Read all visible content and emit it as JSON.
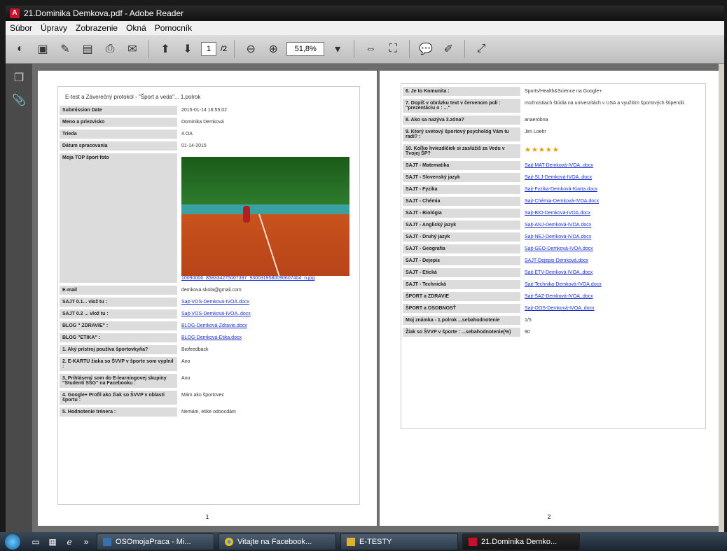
{
  "window": {
    "title": "21.Dominika Demkova.pdf - Adobe Reader"
  },
  "menu": [
    "Súbor",
    "Úpravy",
    "Zobrazenie",
    "Okná",
    "Pomocník"
  ],
  "toolbar": {
    "page_current": "1",
    "page_total": "/2",
    "zoom": "51,8%"
  },
  "page1": {
    "form_title": "E-test a Záverečný protokol - \"Šport a veda\"... 1.polrok",
    "rows": [
      {
        "label": "Submission Date",
        "value": "2015-01-14 16:55:02"
      },
      {
        "label": "Meno a priezvisko",
        "value": "Dominika Demková"
      },
      {
        "label": "Trieda",
        "value": "4.OA"
      },
      {
        "label": "Dátum spracovania",
        "value": "01-14-2015"
      }
    ],
    "photo_label": "Moja TOP šport foto",
    "photo_link": "10090006_858334275007397_9300319580090607404_n.jpg",
    "rows2": [
      {
        "label": "E-mail",
        "value": "demkova.skola@gmail.com"
      },
      {
        "label": "SAJT 0.1... vlož tu :",
        "value": "Sajt-VOS-Demková-IVOA.docx",
        "link": true
      },
      {
        "label": "SAJT 0.2 ... vlož tu :",
        "value": "Sajt-VOS-Demková-IVOA..docx",
        "link": true
      },
      {
        "label": "BLOG \" ZDRAVIE\" :",
        "value": "BLOG-Demková-Zdravie.docx",
        "link": true
      },
      {
        "label": "BLOG \"ETIKA\" :",
        "value": "BLOG-Demková-Etika.docx",
        "link": true
      },
      {
        "label": "1. Aký prístroj používa športovkyňa?",
        "value": "Biofeedback"
      },
      {
        "label": "2. E-KARTU žiaka so ŠVVP v športe som vyplnil :",
        "value": "Ano"
      },
      {
        "label": "3. Prihlásený som do E-learningovej skupiny \"Študenti SŠG\" na Facebooku :",
        "value": "Ano"
      },
      {
        "label": "4. Google+ Profil ako žiak so ŠVVP v oblasti športu :",
        "value": "Mám ako športovec"
      },
      {
        "label": "5. Hodnotenie trénera :",
        "value": "Nemám, etike odoocdám"
      }
    ],
    "page_number": "1"
  },
  "page2": {
    "rows": [
      {
        "label": "6. Je to Komunita :",
        "value": "Sports/Health&Science na Google+"
      },
      {
        "label": "7. Dopíš v obrázku text v červenom poli : \"prezentáciu o : ...\"",
        "value": "možnostiach štúdia na univerzitách v USA a využitím športových štipendií."
      },
      {
        "label": "8. Ako sa nazýva 3.zóna?",
        "value": "anaeróbna"
      },
      {
        "label": "9. Ktorý svetový športový psychológ Vám tu radí? :",
        "value": "Jim Loehr"
      },
      {
        "label": "10. Koľko hviezdičiek si zaslúžiš za Vedu v Tvojej ŠP?",
        "value": "★★★★★",
        "stars": true
      },
      {
        "label": "SAJT - Matematika",
        "value": "Sajt-MAT-Demková-IVOA..docx",
        "link": true
      },
      {
        "label": "SAJT - Slovenský jazyk",
        "value": "Sajt-SLJ-Demková-IVOA..docx",
        "link": true
      },
      {
        "label": "SAJT - Fyzika",
        "value": "Sajt-Fyzika-Demková-Kiarta.docx",
        "link": true
      },
      {
        "label": "SAJT - Chémia",
        "value": "Sajt-Chémia-Demková-IVOA.docx",
        "link": true
      },
      {
        "label": "SAJT - Biológia",
        "value": "Sajt-BIO-Demková-IVOA.docx",
        "link": true
      },
      {
        "label": "SAJT - Anglický jazyk",
        "value": "Sajt-ANJ-Demková-IVOA.docx",
        "link": true
      },
      {
        "label": "SAJT - Druhý jazyk",
        "value": "Sajt-NEJ-Demková-IVOA.docx",
        "link": true
      },
      {
        "label": "SAJT - Geografia",
        "value": "Sajt-GEO-Demková-IVOA.docx",
        "link": true
      },
      {
        "label": "SAJT - Dejepis",
        "value": "SAJT-Dejepis-Demková.docx",
        "link": true
      },
      {
        "label": "SAJT - Etická",
        "value": "Sajt-ETV-Demková-IVOA..docx",
        "link": true
      },
      {
        "label": "SAJT - Technická",
        "value": "Sajt-Technika-Demková-IVOA.docx",
        "link": true
      },
      {
        "label": "ŠPORT a ZDRAVIE",
        "value": "Sajt-ŠAZ-Demková-IVOA..docx",
        "link": true
      },
      {
        "label": "ŠPORT a OSOBNOSŤ",
        "value": "Sajt-OOS-Demková-IVOA..docx",
        "link": true
      },
      {
        "label": "Moj známka - 1.polrok ...sebahodnotenie",
        "value": "1/5"
      },
      {
        "label": "Žiak so ŠVVP v športe : ...sebahodnotenie(%)",
        "value": "90"
      }
    ],
    "page_number": "2"
  },
  "taskbar": {
    "items": [
      {
        "label": "OSOmojaPraca - Mi..."
      },
      {
        "label": "Vitajte na Facebook..."
      },
      {
        "label": "E-TESTY"
      },
      {
        "label": "21.Dominika Demko..."
      }
    ]
  }
}
